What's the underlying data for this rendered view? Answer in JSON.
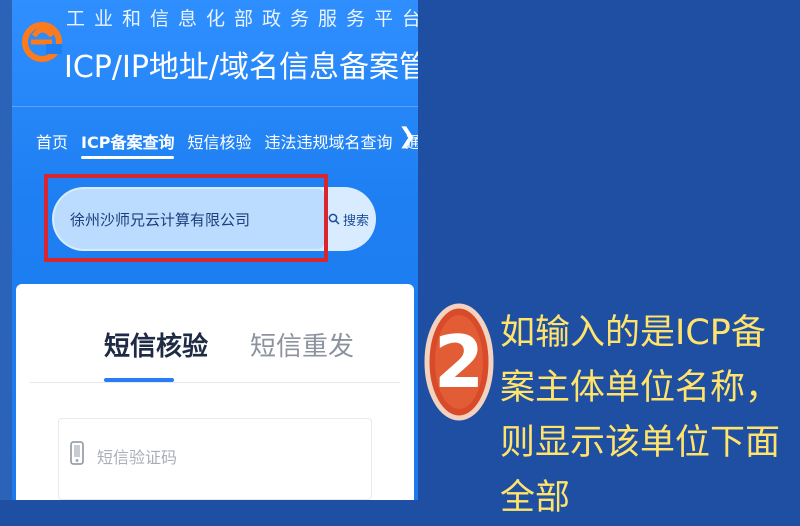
{
  "header": {
    "agency": "工业和信息化部政务服务平台",
    "system_title": "ICP/IP地址/域名信息备案管理系统"
  },
  "nav": {
    "items": [
      {
        "label": "首页"
      },
      {
        "label": "ICP备案查询",
        "active": true
      },
      {
        "label": "短信核验"
      },
      {
        "label": "违法违规域名查询"
      },
      {
        "label": "通知公告"
      }
    ],
    "more": "❯"
  },
  "search": {
    "value": "徐州沙师兄云计算有限公司",
    "button_label": "搜索",
    "icon": "search-icon"
  },
  "card": {
    "tabs": [
      {
        "label": "短信核验",
        "active": true
      },
      {
        "label": "短信重发"
      }
    ],
    "code_field": {
      "placeholder": "短信验证码",
      "icon": "phone-icon"
    }
  },
  "instruction": {
    "step_number": "2",
    "text": "如输入的是ICP备案主体单位名称，则显示该单位下面全部"
  },
  "colors": {
    "header_blue": "#1e7ff2",
    "highlight_red": "#d7262e",
    "caption_yellow": "#ffe36a",
    "background_navy": "#1e4fa3",
    "tab_accent": "#2a7cf4"
  }
}
